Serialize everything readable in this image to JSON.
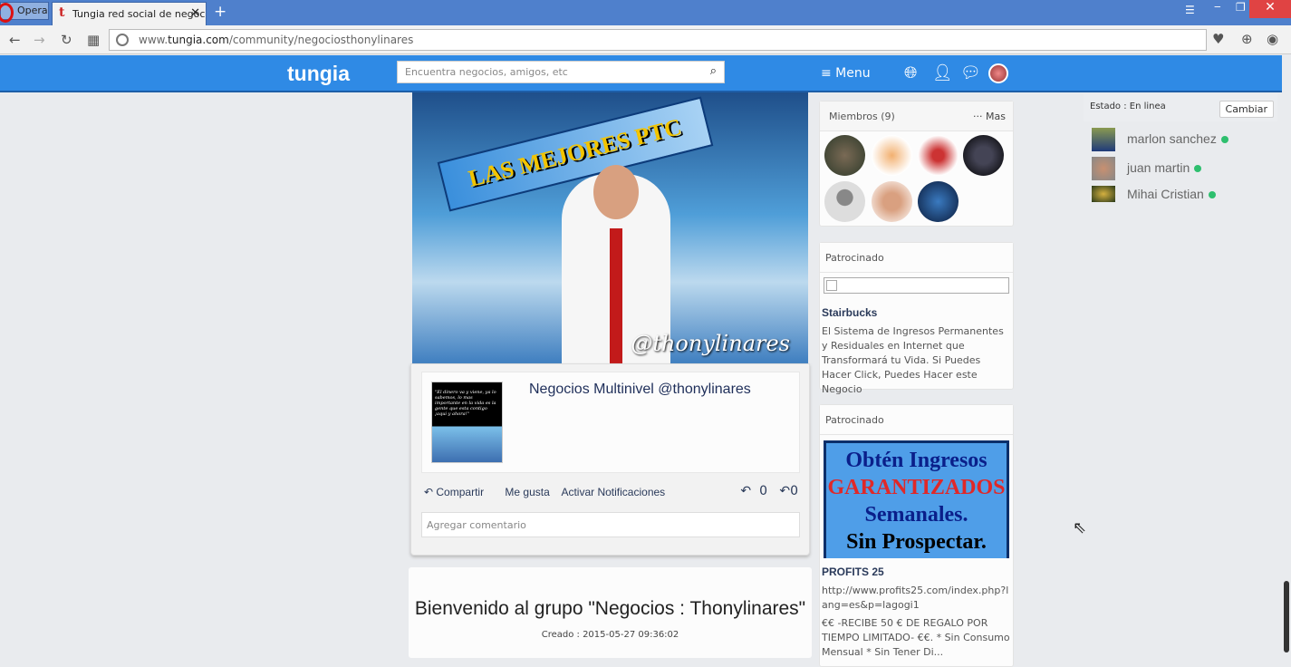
{
  "browser": {
    "opera_label": "Opera",
    "tab_title": "Tungia red social de negocios",
    "tab_favicon": "t",
    "url_prefix": "www.",
    "url_domain": "tungia.com",
    "url_path": "/community/negociosthonylinares"
  },
  "header": {
    "logo": "tungia",
    "search_placeholder": "Encuentra negocios, amigos, etc",
    "menu_label": "≡ Menu"
  },
  "cover": {
    "banner_text": "LAS MEJORES PTC",
    "watermark": "@thonylinares"
  },
  "post": {
    "thumb_quote": "\"El dinero va y viene, ya lo sabemos, lo mas importante en la vida es la gente que esta contigo ¡aqui y ahora!\"",
    "title": "Negocios Multinivel @thonylinares",
    "share": "Compartir",
    "like": "Me gusta",
    "notify": "Activar Notificaciones",
    "reply_count": "0",
    "share_count": "0",
    "comment_placeholder": "Agregar comentario"
  },
  "welcome": {
    "title": "Bienvenido al grupo \"Negocios : Thonylinares\"",
    "created": "Creado : 2015-05-27 09:36:02"
  },
  "members": {
    "title": "Miembros (9)",
    "more": "··· Mas"
  },
  "sponsored1": {
    "title": "Patrocinado",
    "name": "Stairbucks",
    "desc": "El Sistema de Ingresos Permanentes y Residuales en Internet que Transformará tu Vida. Si Puedes Hacer Click, Puedes Hacer este Negocio"
  },
  "sponsored2": {
    "title": "Patrocinado",
    "ad_line1": "Obtén Ingresos",
    "ad_line2": "GARANTIZADOS",
    "ad_line3": "Semanales.",
    "ad_line4": "Sin Prospectar.",
    "name": "PROFITS 25",
    "url": "http://www.profits25.com/index.php?lang=es&p=lagogi1",
    "desc": "€€ -RECIBE 50 € DE REGALO POR TIEMPO LIMITADO- €€. * Sin Consumo Mensual * Sin Tener Di..."
  },
  "chat": {
    "status": "Estado : En linea",
    "change": "Cambiar",
    "friends": [
      {
        "name": "marlon sanchez"
      },
      {
        "name": "juan martin"
      },
      {
        "name": "Mihai Cristian"
      }
    ],
    "online_color": "#2ebf6e"
  }
}
